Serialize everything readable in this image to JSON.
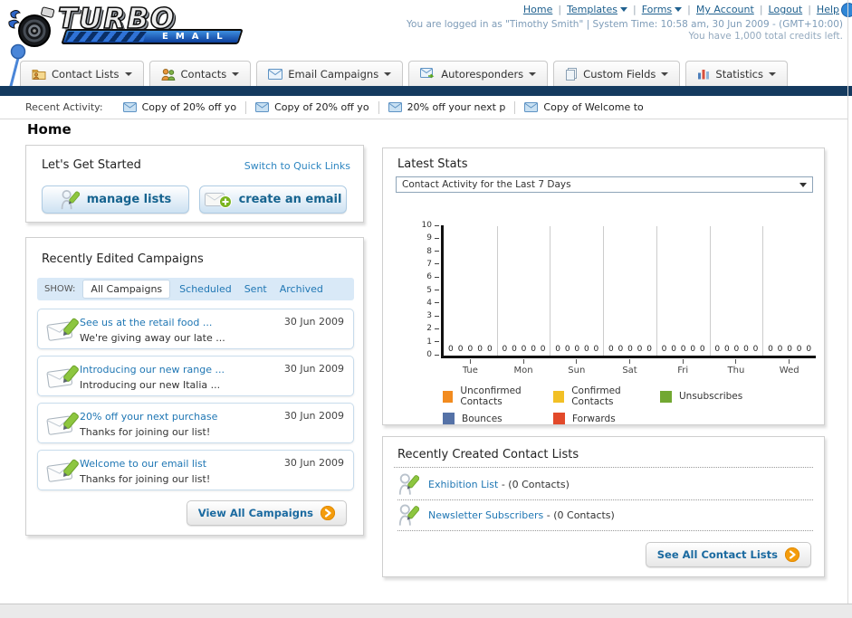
{
  "header": {
    "logo": {
      "line1": "TURBO",
      "line2": "EMAIL"
    },
    "nav_links": [
      {
        "label": "Home",
        "dropdown": false
      },
      {
        "label": "Templates",
        "dropdown": true
      },
      {
        "label": "Forms",
        "dropdown": true
      },
      {
        "label": "My Account",
        "dropdown": false
      },
      {
        "label": "Logout",
        "dropdown": false
      },
      {
        "label": "Help",
        "dropdown": false
      }
    ],
    "login_info": "You are logged in as \"Timothy Smith\" | System Time: 10:58 am, 30 Jun 2009 - (GMT+10:00)",
    "credits_info": "You have 1,000 total credits left."
  },
  "tabs": [
    {
      "label": "Contact Lists"
    },
    {
      "label": "Contacts"
    },
    {
      "label": "Email Campaigns"
    },
    {
      "label": "Autoresponders"
    },
    {
      "label": "Custom Fields"
    },
    {
      "label": "Statistics"
    }
  ],
  "recent_activity": {
    "label": "Recent Activity:",
    "items": [
      "Copy of 20% off yo",
      "Copy of 20% off yo",
      "20% off your next p",
      "Copy of Welcome to"
    ]
  },
  "page_title": "Home",
  "get_started": {
    "title": "Let's Get Started",
    "switch_link": "Switch to Quick Links",
    "manage_lists_label": "manage lists",
    "create_email_label": "create an email"
  },
  "campaigns": {
    "title": "Recently Edited Campaigns",
    "show_label": "SHOW:",
    "filters": [
      "All Campaigns",
      "Scheduled",
      "Sent",
      "Archived"
    ],
    "active_filter": "All Campaigns",
    "items": [
      {
        "title": "See us at the retail food ...",
        "subtitle": "We're giving away our late ...",
        "date": "30 Jun 2009"
      },
      {
        "title": "Introducing our new range ...",
        "subtitle": "Introducing our new Italia ...",
        "date": "30 Jun 2009"
      },
      {
        "title": "20% off your next purchase",
        "subtitle": "Thanks for joining our list!",
        "date": "30 Jun 2009"
      },
      {
        "title": "Welcome to our email list",
        "subtitle": "Thanks for joining our list!",
        "date": "30 Jun 2009"
      }
    ],
    "view_all_label": "View All Campaigns"
  },
  "stats": {
    "title": "Latest Stats",
    "selected_option": "Contact Activity for the Last 7 Days"
  },
  "chart_data": {
    "type": "bar",
    "categories": [
      "Tue",
      "Mon",
      "Sun",
      "Sat",
      "Fri",
      "Thu",
      "Wed"
    ],
    "series": [
      {
        "name": "Unconfirmed Contacts",
        "color": "#F28B1F",
        "values": [
          0,
          0,
          0,
          0,
          0,
          0,
          0
        ]
      },
      {
        "name": "Confirmed Contacts",
        "color": "#F2C025",
        "values": [
          0,
          0,
          0,
          0,
          0,
          0,
          0
        ]
      },
      {
        "name": "Unsubscribes",
        "color": "#72A832",
        "values": [
          0,
          0,
          0,
          0,
          0,
          0,
          0
        ]
      },
      {
        "name": "Bounces",
        "color": "#5572A7",
        "values": [
          0,
          0,
          0,
          0,
          0,
          0,
          0
        ]
      },
      {
        "name": "Forwards",
        "color": "#E2492A",
        "values": [
          0,
          0,
          0,
          0,
          0,
          0,
          0
        ]
      }
    ],
    "title": "Contact Activity for the Last 7 Days",
    "xlabel": "",
    "ylabel": "",
    "ylim": [
      0,
      10
    ],
    "ytick_step": 1,
    "grid": "vertical-group-separators",
    "legend_position": "bottom",
    "value_labels_shown": true
  },
  "contact_lists": {
    "title": "Recently Created Contact Lists",
    "items": [
      {
        "name": "Exhibition List",
        "suffix": " - (0 Contacts)"
      },
      {
        "name": "Newsletter Subscribers",
        "suffix": " - (0 Contacts)"
      }
    ],
    "see_all_label": "See All Contact Lists"
  }
}
